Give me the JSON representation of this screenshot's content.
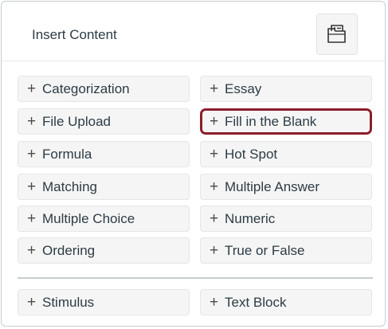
{
  "header": {
    "title": "Insert Content",
    "folder_button_icon": "folder-image-icon"
  },
  "items": [
    {
      "label": "Categorization",
      "selected": false
    },
    {
      "label": "Essay",
      "selected": false
    },
    {
      "label": "File Upload",
      "selected": false
    },
    {
      "label": "Fill in the Blank",
      "selected": true
    },
    {
      "label": "Formula",
      "selected": false
    },
    {
      "label": "Hot Spot",
      "selected": false
    },
    {
      "label": "Matching",
      "selected": false
    },
    {
      "label": "Multiple Answer",
      "selected": false
    },
    {
      "label": "Multiple Choice",
      "selected": false
    },
    {
      "label": "Numeric",
      "selected": false
    },
    {
      "label": "Ordering",
      "selected": false
    },
    {
      "label": "True or False",
      "selected": false
    }
  ],
  "extra_items": [
    {
      "label": "Stimulus"
    },
    {
      "label": "Text Block"
    }
  ],
  "plus_glyph": "+",
  "colors": {
    "selected_border": "#8b1e2a",
    "item_background": "#f5f5f5",
    "text": "#2d3b45"
  }
}
